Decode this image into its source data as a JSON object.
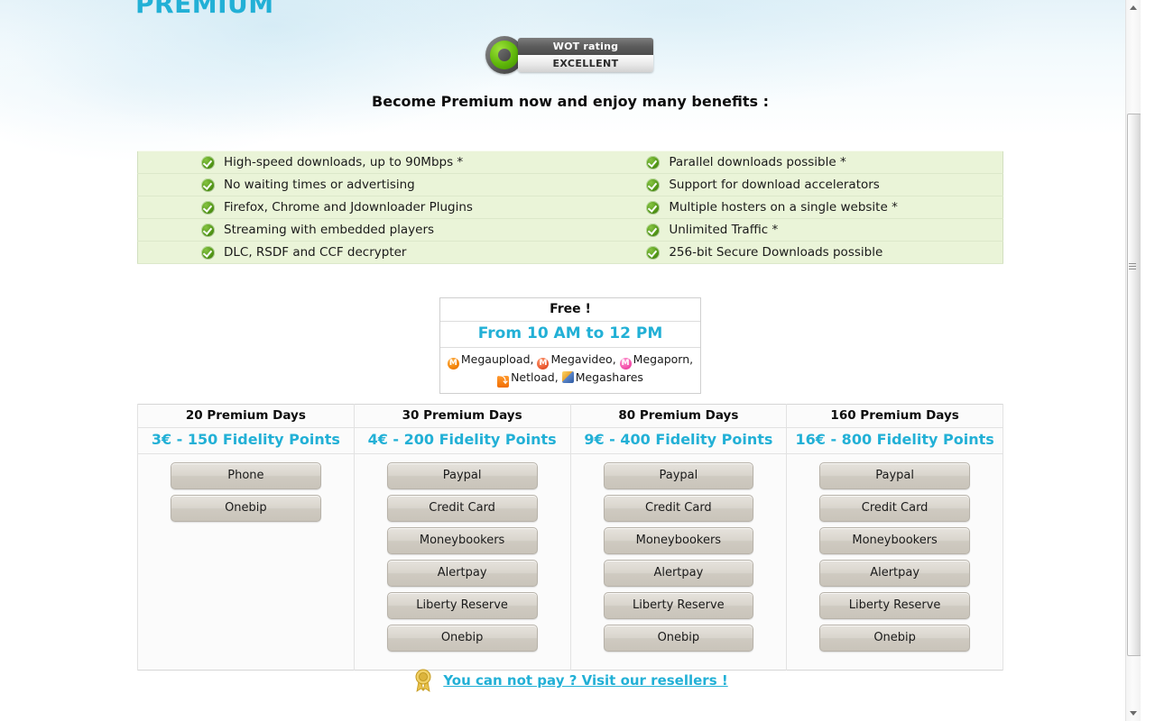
{
  "page": {
    "title": "PREMIUM",
    "heading": "Become Premium now and enjoy many benefits :",
    "accent_color": "#22b0d6",
    "benefit_row_bg": "#eaf4d8"
  },
  "wot_badge": {
    "icon": "wot-ring-icon",
    "top_label": "WOT rating",
    "rating": "EXCELLENT"
  },
  "benefits": {
    "check_icon": "green-check-icon",
    "left": [
      "High-speed downloads, up to 90Mbps *",
      "No waiting times or advertising",
      "Firefox, Chrome and Jdownloader Plugins",
      "Streaming with embedded players",
      "DLC, RSDF and CCF decrypter"
    ],
    "right": [
      "Parallel downloads possible *",
      "Support for download accelerators",
      "Multiple hosters on a single website *",
      "Unlimited Traffic *",
      "256-bit Secure Downloads possible"
    ]
  },
  "free_box": {
    "title": "Free !",
    "hours": "From 10 AM to 12 PM",
    "hosters_line1": [
      {
        "icon": "megaupload-icon",
        "glyph": "M",
        "name": "Megaupload,"
      },
      {
        "icon": "megavideo-icon",
        "glyph": "M",
        "name": "Megavideo,"
      },
      {
        "icon": "megaporn-icon",
        "glyph": "M",
        "name": "Megaporn,"
      }
    ],
    "hosters_line2": [
      {
        "icon": "netload-icon",
        "glyph": "⤵",
        "name": "Netload,"
      },
      {
        "icon": "megashares-icon",
        "glyph": "",
        "name": "Megashares"
      }
    ]
  },
  "pricing": {
    "columns": [
      {
        "days": "20 Premium Days",
        "price": "3€ - 150 Fidelity Points",
        "methods": [
          "Phone",
          "Onebip"
        ]
      },
      {
        "days": "30 Premium Days",
        "price": "4€ - 200 Fidelity Points",
        "methods": [
          "Paypal",
          "Credit Card",
          "Moneybookers",
          "Alertpay",
          "Liberty Reserve",
          "Onebip"
        ]
      },
      {
        "days": "80 Premium Days",
        "price": "9€ - 400 Fidelity Points",
        "methods": [
          "Paypal",
          "Credit Card",
          "Moneybookers",
          "Alertpay",
          "Liberty Reserve",
          "Onebip"
        ]
      },
      {
        "days": "160 Premium Days",
        "price": "16€ - 800 Fidelity Points",
        "methods": [
          "Paypal",
          "Credit Card",
          "Moneybookers",
          "Alertpay",
          "Liberty Reserve",
          "Onebip"
        ]
      }
    ]
  },
  "resellers": {
    "icon": "award-medal-icon",
    "link_text": "You can not pay ? Visit our resellers !"
  },
  "scrollbar": {
    "up_arrow_icon": "scroll-up-arrow-icon",
    "down_arrow_icon": "scroll-down-arrow-icon",
    "thumb": "scrollbar-thumb"
  }
}
